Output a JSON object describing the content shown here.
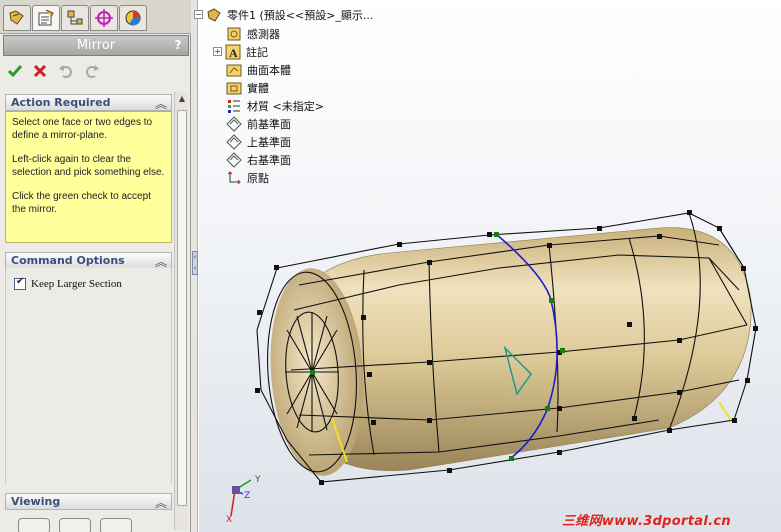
{
  "tabs": [
    {
      "icon": "feature-manager-icon"
    },
    {
      "icon": "property-manager-icon"
    },
    {
      "icon": "configuration-manager-icon"
    },
    {
      "icon": "dimxpert-icon"
    },
    {
      "icon": "display-manager-icon"
    }
  ],
  "property_manager": {
    "title": "Mirror",
    "help": "?",
    "ok_icon": "green-check-icon",
    "cancel_icon": "red-x-icon"
  },
  "action_required": {
    "title": "Action Required",
    "lines": [
      "Select one face or two edges to define a mirror-plane.",
      "Left-click again to clear the selection and pick something else.",
      "Click the green check to accept the mirror."
    ]
  },
  "command_options": {
    "title": "Command Options",
    "keep_larger_label": "Keep Larger Section",
    "keep_larger_checked": true
  },
  "viewing": {
    "title": "Viewing"
  },
  "tree": {
    "root": "零件1 (預設<<預設>_顯示...",
    "items": [
      "感測器",
      "註記",
      "曲面本體",
      "實體",
      "材質 <未指定>",
      "前基準面",
      "上基準面",
      "右基準面",
      "原點"
    ]
  },
  "triad": {
    "x": "X",
    "y": "Y",
    "z": "Z"
  },
  "watermark": "三维网www.3dportal.cn",
  "colors": {
    "accent_yellow": "#ffff9c",
    "model_tan": "#d9c596",
    "mirror_curve": "#1d1dcf",
    "ok_green": "#2e9a2e",
    "cancel_red": "#cc1f1f"
  }
}
